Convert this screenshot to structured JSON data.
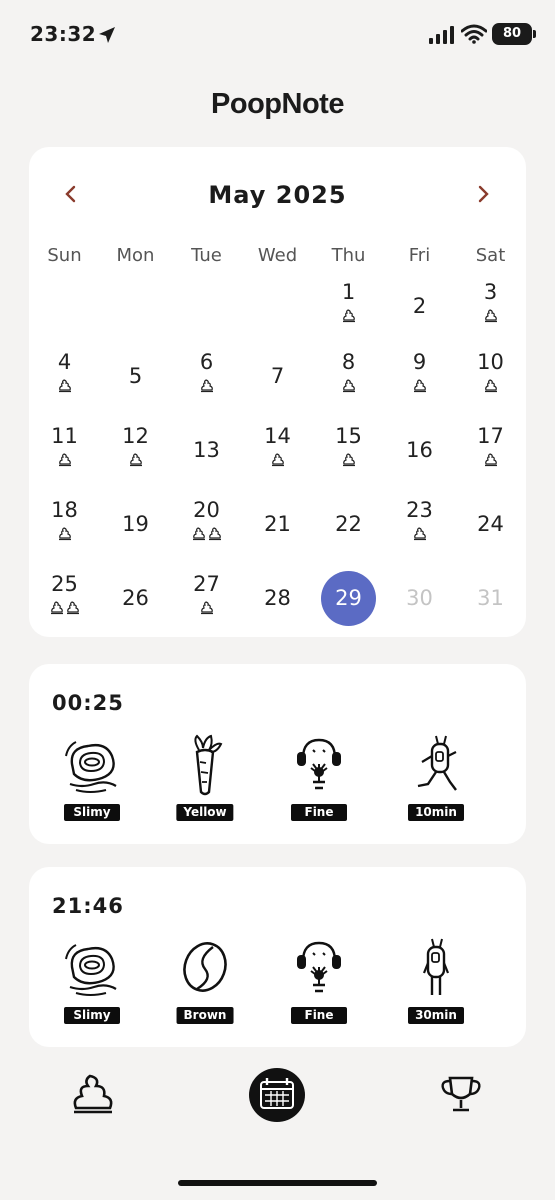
{
  "status_bar": {
    "time": "23:32",
    "battery": "80",
    "icons": [
      "location-arrow-icon",
      "cellular-signal-icon",
      "wifi-icon",
      "battery-icon"
    ]
  },
  "app": {
    "title": "PoopNote"
  },
  "calendar": {
    "month_label": "May 2025",
    "prev_icon": "chevron-left-icon",
    "next_icon": "chevron-right-icon",
    "weekdays": [
      "Sun",
      "Mon",
      "Tue",
      "Wed",
      "Thu",
      "Fri",
      "Sat"
    ],
    "first_weekday": 4,
    "today": 29,
    "days": [
      {
        "day": "1",
        "poops": 1
      },
      {
        "day": "2",
        "poops": 0
      },
      {
        "day": "3",
        "poops": 1
      },
      {
        "day": "4",
        "poops": 1
      },
      {
        "day": "5",
        "poops": 0
      },
      {
        "day": "6",
        "poops": 1
      },
      {
        "day": "7",
        "poops": 0
      },
      {
        "day": "8",
        "poops": 1
      },
      {
        "day": "9",
        "poops": 1
      },
      {
        "day": "10",
        "poops": 1
      },
      {
        "day": "11",
        "poops": 1
      },
      {
        "day": "12",
        "poops": 1
      },
      {
        "day": "13",
        "poops": 0
      },
      {
        "day": "14",
        "poops": 1
      },
      {
        "day": "15",
        "poops": 1
      },
      {
        "day": "16",
        "poops": 0
      },
      {
        "day": "17",
        "poops": 1
      },
      {
        "day": "18",
        "poops": 1
      },
      {
        "day": "19",
        "poops": 0
      },
      {
        "day": "20",
        "poops": 2
      },
      {
        "day": "21",
        "poops": 0
      },
      {
        "day": "22",
        "poops": 0
      },
      {
        "day": "23",
        "poops": 1
      },
      {
        "day": "24",
        "poops": 0
      },
      {
        "day": "25",
        "poops": 2
      },
      {
        "day": "26",
        "poops": 0
      },
      {
        "day": "27",
        "poops": 1
      },
      {
        "day": "28",
        "poops": 0
      },
      {
        "day": "29",
        "poops": 0
      },
      {
        "day": "30",
        "poops": 0
      },
      {
        "day": "31",
        "poops": 0
      }
    ]
  },
  "entries": [
    {
      "time": "00:25",
      "attributes": [
        {
          "icon": "slimy-texture-icon",
          "label": "Slimy"
        },
        {
          "icon": "carrot-color-icon",
          "label": "Yellow"
        },
        {
          "icon": "fine-feeling-icon",
          "label": "Fine"
        },
        {
          "icon": "running-duration-icon",
          "label": "10min"
        }
      ]
    },
    {
      "time": "21:46",
      "attributes": [
        {
          "icon": "slimy-texture-icon",
          "label": "Slimy"
        },
        {
          "icon": "coffee-bean-color-icon",
          "label": "Brown"
        },
        {
          "icon": "fine-feeling-icon",
          "label": "Fine"
        },
        {
          "icon": "standing-duration-icon",
          "label": "30min"
        }
      ]
    }
  ],
  "tabbar": {
    "tabs": [
      "poop-log-icon",
      "calendar-icon",
      "trophy-icon"
    ],
    "active": "calendar-icon"
  },
  "colors": {
    "background": "#f4f3f2",
    "card": "#ffffff",
    "today_circle": "#5b6bc4",
    "nav_arrow": "#8a3b2c",
    "future_day": "#c4c4c4",
    "tag": "#0d0d0d"
  }
}
